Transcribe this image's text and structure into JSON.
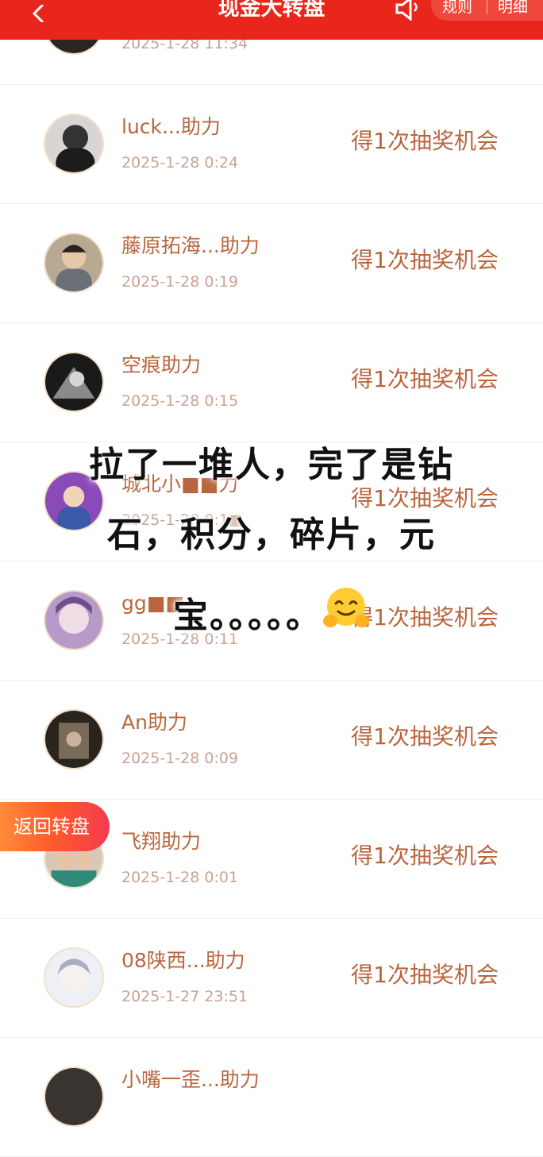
{
  "header": {
    "title": "现金大转盘",
    "rules_label": "规则",
    "detail_label": "明细"
  },
  "rows": [
    {
      "name": "",
      "date": "2025-1-28 11:34",
      "reward": ""
    },
    {
      "name": "luck...助力",
      "date": "2025-1-28 0:24",
      "reward": "得1次抽奖机会"
    },
    {
      "name": "藤原拓海...助力",
      "date": "2025-1-28 0:19",
      "reward": "得1次抽奖机会"
    },
    {
      "name": "空痕助力",
      "date": "2025-1-28 0:15",
      "reward": "得1次抽奖机会"
    },
    {
      "name": "城北小■■力",
      "date": "2025-1-28 0:1■",
      "reward": "得1次抽奖机会"
    },
    {
      "name": "gg■■",
      "date": "2025-1-28 0:11",
      "reward": "得1次抽奖机会"
    },
    {
      "name": "An助力",
      "date": "2025-1-28 0:09",
      "reward": "得1次抽奖机会"
    },
    {
      "name": "飞翔助力",
      "date": "2025-1-28 0:01",
      "reward": "得1次抽奖机会"
    },
    {
      "name": "08陕西...助力",
      "date": "2025-1-27 23:51",
      "reward": "得1次抽奖机会"
    },
    {
      "name": "小嘴一歪...助力",
      "date": "",
      "reward": ""
    }
  ],
  "overlay": {
    "line1": "拉了一堆人，完了是钻",
    "line2": "石，积分，碎片，元",
    "line3": "宝。。。。。",
    "emoji": "hugging-face-emoji"
  },
  "return_button": {
    "label": "返回转盘"
  }
}
